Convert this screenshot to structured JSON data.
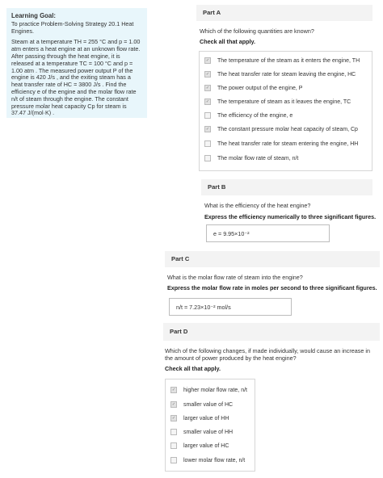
{
  "goal": {
    "title": "Learning Goal:",
    "subtitle": "To practice Problem-Solving Strategy 20.1 Heat Engines.",
    "body": "Steam at a temperature TH = 255 °C and p = 1.00 atm enters a heat engine at an unknown flow rate. After passing through the heat engine, it is released at a temperature TC = 100 °C and p = 1.00 atm . The measured power output P of the engine is 420 J/s , and the exiting steam has a heat transfer rate of HC = 3800 J/s . Find the efficiency e of the engine and the molar flow rate n/t of steam through the engine. The constant pressure molar heat capacity Cp for steam is 37.47 J/(mol·K) ."
  },
  "partA": {
    "header": "Part A",
    "question": "Which of the following quantities are known?",
    "instruction": "Check all that apply.",
    "options": [
      {
        "label": "The temperature of the steam as it enters the engine, TH",
        "checked": true
      },
      {
        "label": "The heat transfer rate for steam leaving the engine, HC",
        "checked": true
      },
      {
        "label": "The power output of the engine, P",
        "checked": true
      },
      {
        "label": "The temperature of steam as it leaves the engine, TC",
        "checked": true
      },
      {
        "label": "The efficiency of the engine, e",
        "checked": false
      },
      {
        "label": "The constant pressure molar heat capacity of steam, Cp",
        "checked": true
      },
      {
        "label": "The heat transfer rate for steam entering the engine, HH",
        "checked": false
      },
      {
        "label": "The molar flow rate of steam, n/t",
        "checked": false
      }
    ]
  },
  "partB": {
    "header": "Part B",
    "question": "What is the efficiency of the heat engine?",
    "instruction": "Express the efficiency numerically to three significant figures.",
    "answer": "e =  9.95×10⁻²"
  },
  "partC": {
    "header": "Part C",
    "question": "What is the molar flow rate of steam into the engine?",
    "instruction": "Express the molar flow rate in moles per second to three significant figures.",
    "answer": "n/t =  7.23×10⁻²  mol/s"
  },
  "partD": {
    "header": "Part D",
    "question": "Which of the following changes, if made individually, would cause an increase in the amount of power produced by the heat engine?",
    "instruction": "Check all that apply.",
    "options": [
      {
        "label": "higher molar flow rate, n/t",
        "checked": true
      },
      {
        "label": "smaller value of HC",
        "checked": true
      },
      {
        "label": "larger value of HH",
        "checked": true
      },
      {
        "label": "smaller value of HH",
        "checked": false
      },
      {
        "label": "larger value of HC",
        "checked": false
      },
      {
        "label": "lower molar flow rate, n/t",
        "checked": false
      }
    ]
  }
}
